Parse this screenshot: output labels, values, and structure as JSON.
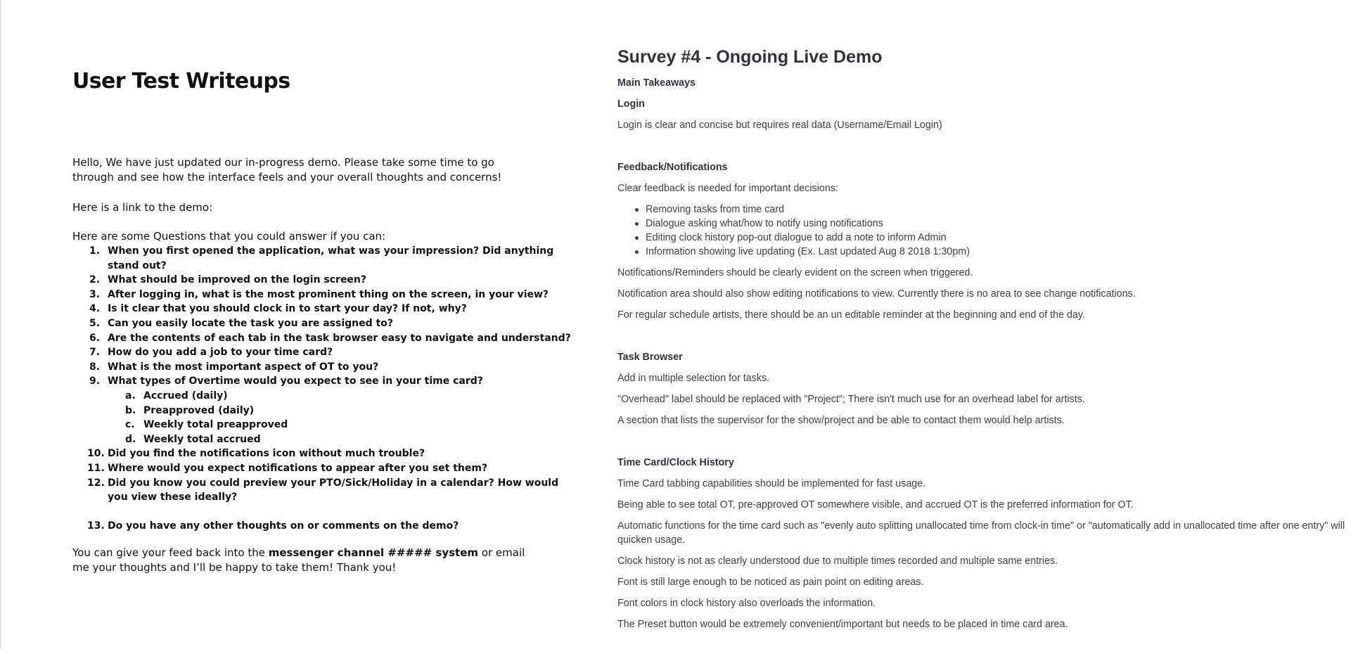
{
  "left": {
    "title": "User Test Writeups",
    "intro": "Hello, We have just updated our in-progress demo. Please take some time to go through and see how the interface feels and your overall thoughts and concerns!",
    "demo_link_text": "Here is a link to the demo:",
    "questions_intro": "Here are some Questions that you could answer if you can:",
    "questions": [
      {
        "num": "1.",
        "text": "When you first opened the application, what was your impression? Did anything stand out?"
      },
      {
        "num": "2.",
        "text": "What should be improved on the login screen?"
      },
      {
        "num": "3.",
        "text": "After logging in, what is the most prominent thing on the screen, in your view?"
      },
      {
        "num": "4.",
        "text": "Is it clear that you should clock in to start your day? If not, why?"
      },
      {
        "num": "5.",
        "text": "Can you easily locate the task you are assigned to?"
      },
      {
        "num": "6.",
        "text": "Are the contents of each tab in the task browser easy to navigate and understand?"
      },
      {
        "num": "7.",
        "text": "How do you add a job to your time card?"
      },
      {
        "num": "8.",
        "text": "What is the most important aspect of OT to you?"
      },
      {
        "num": "9.",
        "text": "What types of Overtime would you expect to see in your time card?"
      },
      {
        "num": "10.",
        "text": "Did you find the notifications icon without much trouble?"
      },
      {
        "num": "11.",
        "text": "Where would you expect notifications to appear after you set them?"
      },
      {
        "num": "12.",
        "text": "Did you know you could preview your PTO/Sick/Holiday in a calendar? How would you view these ideally?"
      },
      {
        "num": "13.",
        "text": "Do you have any other thoughts on or comments on the demo?"
      }
    ],
    "overtime_options": [
      {
        "num": "a.",
        "text": "Accrued (daily)"
      },
      {
        "num": "b.",
        "text": "Preapproved (daily)"
      },
      {
        "num": "c.",
        "text": "Weekly total preapproved"
      },
      {
        "num": "d.",
        "text": "Weekly total accrued"
      }
    ],
    "outro_before": "You can give your feed back into the ",
    "outro_bold": "messenger channel ##### system",
    "outro_after": " or email me your thoughts and I’ll be happy to take them! Thank you!"
  },
  "right": {
    "title": "Survey #4 - Ongoing Live Demo",
    "main_takeaways": "Main Takeaways",
    "login_heading": "Login",
    "login_text": "Login is clear and concise but requires real data (Username/Email Login)",
    "feedback_heading": "Feedback/Notifications",
    "feedback_intro": "Clear feedback is needed for important decisions:",
    "feedback_bullets": [
      "Removing tasks from time card",
      "Dialogue asking what/how to notify using notifications",
      "Editing clock history pop-out dialogue to add a note to inform Admin",
      "Information showing live updating (Ex. Last updated Aug 8 2018 1:30pm)"
    ],
    "feedback_notes": [
      "Notifications/Reminders should be clearly evident on the screen when triggered.",
      "Notification area should also show editing notifications to view. Currently there is no area to see change notifications.",
      "For regular schedule artists, there should be an un editable reminder at the beginning and end of the day."
    ],
    "task_heading": "Task Browser",
    "task_notes": [
      "Add in multiple selection for tasks.",
      "\"Overhead\" label should be replaced with \"Project\"; There isn't much use for an overhead label for artists.",
      "A section that lists the supervisor for the show/project and be able to contact them would help artists."
    ],
    "timecard_heading": "Time Card/Clock History",
    "timecard_notes": [
      "Time Card tabbing capabilities should be implemented for fast usage.",
      "Being able to see total OT, pre-approved OT somewhere visible, and accrued OT is the preferred information for OT.",
      "Automatic functions for the time card such as \"evenly auto splitting unallocated time from clock-in time\" or \"automatically add in unallocated time after one entry\" will quicken usage.",
      "Clock history is not as clearly understood due to multiple times recorded and multiple same entries.",
      "Font is still large enough to be noticed as pain point on editing areas.",
      "Font colors in clock history also overloads the information.",
      "The Preset button would be extremely convenient/important but needs to be placed in time card area."
    ]
  }
}
